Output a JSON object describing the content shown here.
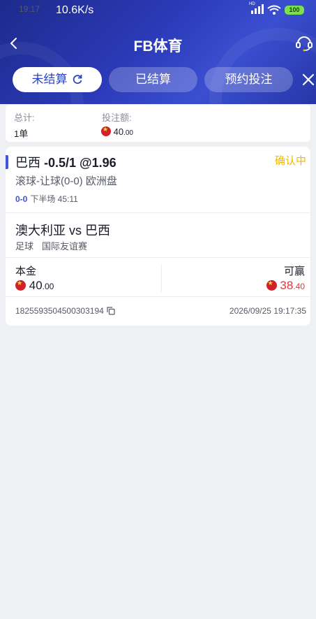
{
  "status_bar": {
    "time": "19:17",
    "speed": "10.6K/s",
    "network_label": "HD",
    "battery": "100"
  },
  "navbar": {
    "title": "FB体育",
    "back_icon": "chevron-left-icon",
    "support_icon": "headset-icon"
  },
  "tabs": [
    {
      "label": "未结算",
      "active": true,
      "icon": "refresh-icon"
    },
    {
      "label": "已结算",
      "active": false
    },
    {
      "label": "预约投注",
      "active": false
    }
  ],
  "summary": {
    "total_label": "总计:",
    "total_value": "1单",
    "stake_label": "投注额:",
    "stake_int": "40",
    "stake_dec": ".00"
  },
  "bet": {
    "team": "巴西",
    "handicap_odds": "-0.5/1 @1.96",
    "status": "确认中",
    "market": "滚球-让球(0-0) 欧洲盘",
    "live_score": "0-0",
    "live_time": "下半场 45:11",
    "match": "澳大利亚 vs 巴西",
    "sport": "足球",
    "league": "国际友谊赛",
    "stake_label": "本金",
    "stake_int": "40",
    "stake_dec": ".00",
    "win_label": "可赢",
    "win_int": "38",
    "win_dec": ".40",
    "order_id": "1825593504500303194",
    "datetime": "2026/09/25 19:17:35"
  },
  "colors": {
    "accent": "#3b55e0",
    "pending": "#f0b800",
    "win": "#e0383e",
    "header": "#2b3ab8"
  }
}
